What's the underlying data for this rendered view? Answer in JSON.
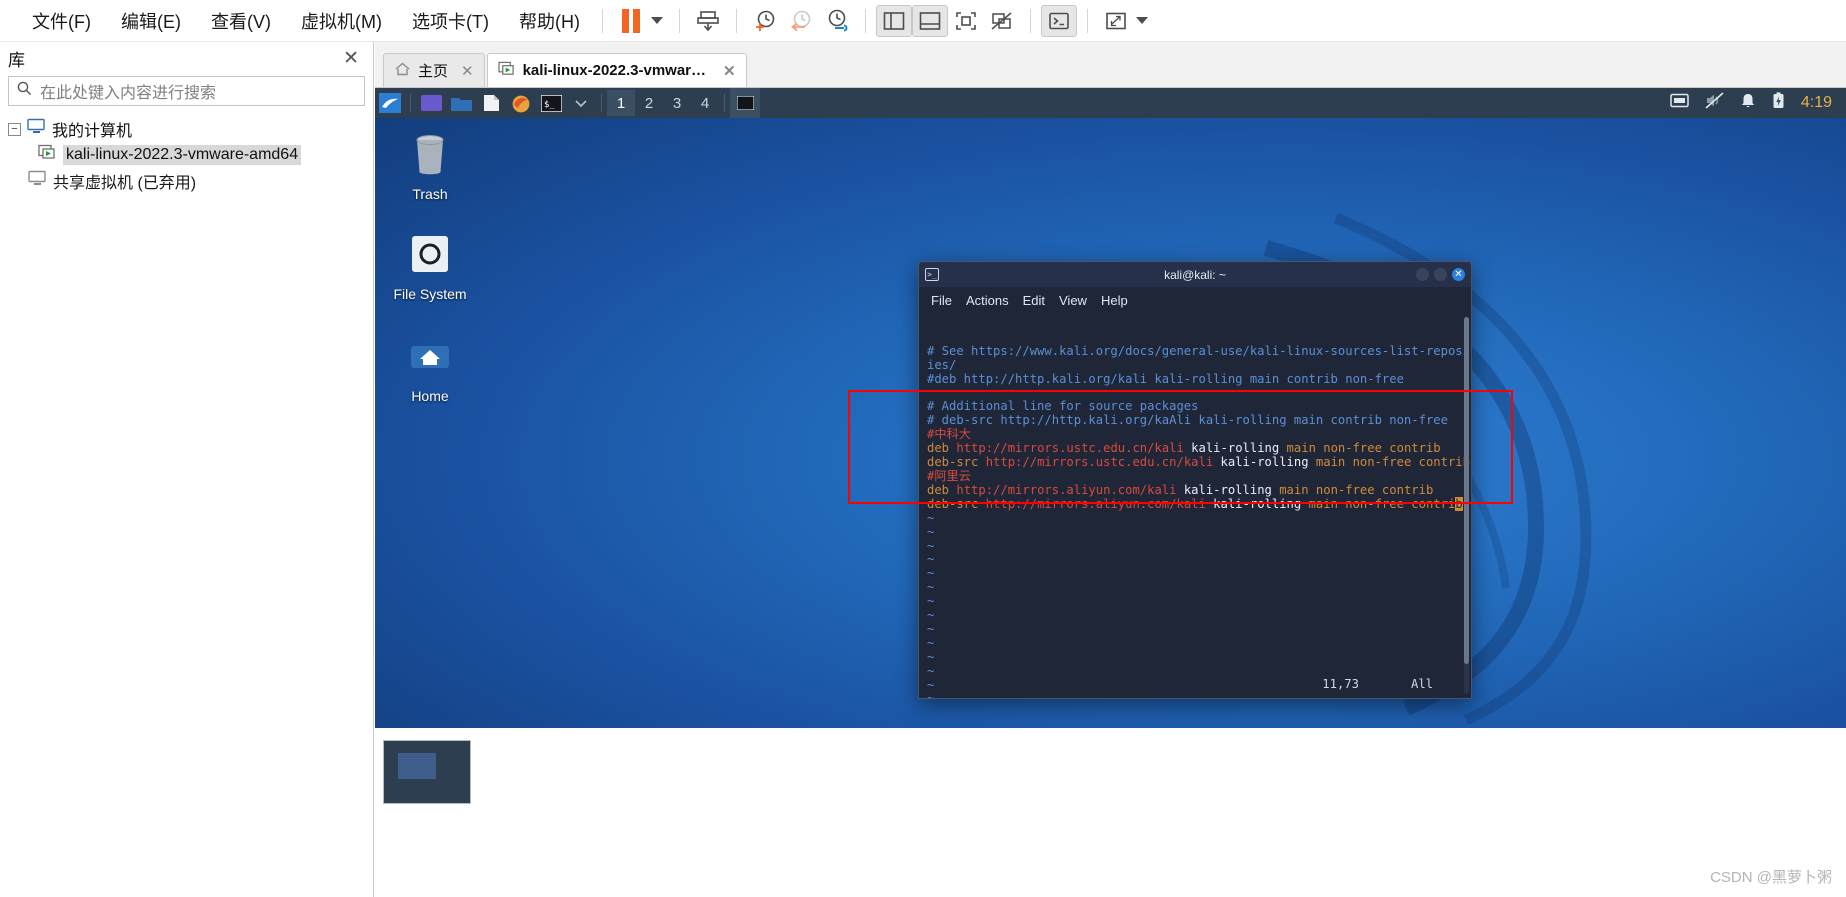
{
  "app": {
    "menu": [
      {
        "label": "文件(F)"
      },
      {
        "label": "编辑(E)"
      },
      {
        "label": "查看(V)"
      },
      {
        "label": "虚拟机(M)"
      },
      {
        "label": "选项卡(T)"
      },
      {
        "label": "帮助(H)"
      }
    ],
    "toolbar": [
      {
        "name": "suspend-button",
        "icon": "pause-icon"
      },
      {
        "name": "suspend-dropdown",
        "icon": "caret-down-icon"
      },
      {
        "name": "power-button",
        "icon": "power-down-icon"
      },
      {
        "name": "take-snapshot-button",
        "icon": "snapshot-add-icon"
      },
      {
        "name": "revert-snapshot-button",
        "icon": "snapshot-revert-icon"
      },
      {
        "name": "snapshot-manager-button",
        "icon": "snapshot-manage-icon"
      },
      {
        "name": "show-library-button",
        "icon": "panel-left-icon"
      },
      {
        "name": "show-thumbnail-bar-button",
        "icon": "panel-bottom-icon"
      },
      {
        "name": "fullscreen-button",
        "icon": "fullscreen-icon"
      },
      {
        "name": "unity-button",
        "icon": "unity-icon"
      },
      {
        "name": "console-view-button",
        "icon": "console-icon"
      },
      {
        "name": "stretch-button",
        "icon": "stretch-icon"
      },
      {
        "name": "stretch-dropdown",
        "icon": "caret-down-icon"
      }
    ]
  },
  "library": {
    "title": "库",
    "close_label": "✕",
    "search": {
      "placeholder": "在此处键入内容进行搜索",
      "value": ""
    },
    "tree": [
      {
        "label": "我的计算机",
        "expander": "−",
        "icon": "computer-icon",
        "selected": false
      },
      {
        "label": "kali-linux-2022.3-vmware-amd64",
        "icon": "vm-running-icon",
        "selected": true
      },
      {
        "label": "共享虚拟机 (已弃用)",
        "icon": "shared-vm-icon",
        "selected": false
      }
    ]
  },
  "tabs": [
    {
      "label": "主页",
      "icon": "home-icon",
      "active": false,
      "close": "✕"
    },
    {
      "label": "kali-linux-2022.3-vmware-...",
      "icon": "vm-running-icon",
      "active": true,
      "close": "✕"
    }
  ],
  "guest": {
    "panel": {
      "launcher_icon": "kali-dragon-icon",
      "quick_launch": [
        {
          "name": "terminal-emulator-icon"
        },
        {
          "name": "file-manager-icon"
        },
        {
          "name": "text-editor-icon"
        },
        {
          "name": "firefox-icon"
        },
        {
          "name": "root-terminal-icon"
        },
        {
          "name": "quick-launch-dropdown-icon"
        }
      ],
      "workspaces": [
        "1",
        "2",
        "3",
        "4"
      ],
      "active_workspace": "1",
      "window_button_icon": "terminal-window-icon",
      "tray": [
        {
          "name": "display-icon"
        },
        {
          "name": "volume-muted-icon"
        },
        {
          "name": "notification-bell-icon"
        },
        {
          "name": "battery-icon"
        }
      ],
      "clock": "4:19"
    },
    "desktop_icons": [
      {
        "label": "Trash",
        "icon": "trash-icon"
      },
      {
        "label": "File System",
        "icon": "filesystem-icon"
      },
      {
        "label": "Home",
        "icon": "home-folder-icon"
      }
    ]
  },
  "terminal": {
    "title": "kali@kali: ~",
    "window_icon": "terminal-icon",
    "buttons": [
      {
        "name": "minimize-button",
        "label": ""
      },
      {
        "name": "maximize-button",
        "label": ""
      },
      {
        "name": "close-button",
        "label": "✕"
      }
    ],
    "menu": [
      "File",
      "Actions",
      "Edit",
      "View",
      "Help"
    ],
    "lines": [
      [
        {
          "t": "# See https://www.kali.org/docs/general-use/kali-linux-sources-list-repositor",
          "c": "c-blue"
        }
      ],
      [
        {
          "t": "ies/",
          "c": "c-blue"
        }
      ],
      [
        {
          "t": "#deb http://http.kali.org/kali kali-rolling main contrib non-free",
          "c": "c-blue"
        }
      ],
      [
        {
          "t": "",
          "c": "c-blue"
        }
      ],
      [
        {
          "t": "# Additional line for source packages",
          "c": "c-blue"
        }
      ],
      [
        {
          "t": "# deb-src http://http.kali.org/kaAli kali-rolling main contrib non-free",
          "c": "c-blue"
        }
      ],
      [
        {
          "t": "#中科大",
          "c": "c-red"
        }
      ],
      [
        {
          "t": "deb ",
          "c": "c-orange"
        },
        {
          "t": "http://mirrors.ustc.edu.cn/kali",
          "c": "c-red"
        },
        {
          "t": " kali-rolling",
          "c": "c-white"
        },
        {
          "t": " main non-free contrib",
          "c": "c-orange"
        }
      ],
      [
        {
          "t": "deb-src ",
          "c": "c-orange"
        },
        {
          "t": "http://mirrors.ustc.edu.cn/kali",
          "c": "c-red"
        },
        {
          "t": " kali-rolling",
          "c": "c-white"
        },
        {
          "t": " main non-free contrib",
          "c": "c-orange"
        }
      ],
      [
        {
          "t": "#阿里云",
          "c": "c-red"
        }
      ],
      [
        {
          "t": "deb ",
          "c": "c-orange"
        },
        {
          "t": "http://mirrors.aliyun.com/kali",
          "c": "c-red"
        },
        {
          "t": " kali-rolling",
          "c": "c-white"
        },
        {
          "t": " main non-free contrib",
          "c": "c-orange"
        }
      ],
      [
        {
          "t": "deb-src ",
          "c": "c-orange"
        },
        {
          "t": "http://mirrors.aliyun.com/kali",
          "c": "c-red"
        },
        {
          "t": " kali-rolling",
          "c": "c-white"
        },
        {
          "t": " main non-free contri",
          "c": "c-orange"
        },
        {
          "t": "b",
          "c": "cursor"
        }
      ],
      [
        {
          "t": "~",
          "c": "c-blue"
        }
      ],
      [
        {
          "t": "~",
          "c": "c-blue"
        }
      ],
      [
        {
          "t": "~",
          "c": "c-blue"
        }
      ],
      [
        {
          "t": "~",
          "c": "c-blue"
        }
      ],
      [
        {
          "t": "~",
          "c": "c-blue"
        }
      ],
      [
        {
          "t": "~",
          "c": "c-blue"
        }
      ],
      [
        {
          "t": "~",
          "c": "c-blue"
        }
      ],
      [
        {
          "t": "~",
          "c": "c-blue"
        }
      ],
      [
        {
          "t": "~",
          "c": "c-blue"
        }
      ],
      [
        {
          "t": "~",
          "c": "c-blue"
        }
      ],
      [
        {
          "t": "~",
          "c": "c-blue"
        }
      ],
      [
        {
          "t": "~",
          "c": "c-blue"
        }
      ],
      [
        {
          "t": "~",
          "c": "c-blue"
        }
      ],
      [
        {
          "t": "~",
          "c": "c-blue"
        }
      ],
      [
        {
          "t": "~",
          "c": "c-blue"
        }
      ]
    ],
    "status": {
      "position": "11,73",
      "scroll": "All"
    }
  },
  "annotation": {
    "color": "#ff0000"
  },
  "watermark": "CSDN @黑萝卜粥"
}
